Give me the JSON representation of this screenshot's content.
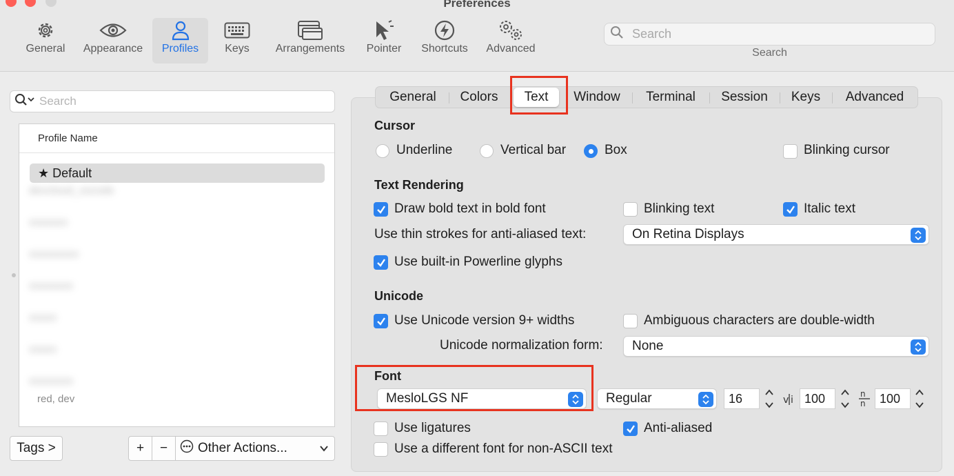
{
  "window": {
    "title": "Preferences"
  },
  "toolbar": {
    "items": [
      {
        "label": "General",
        "icon": "gear-icon"
      },
      {
        "label": "Appearance",
        "icon": "eye-icon"
      },
      {
        "label": "Profiles",
        "icon": "person-icon",
        "active": true
      },
      {
        "label": "Keys",
        "icon": "keyboard-icon"
      },
      {
        "label": "Arrangements",
        "icon": "windows-icon"
      },
      {
        "label": "Pointer",
        "icon": "pointer-icon"
      },
      {
        "label": "Shortcuts",
        "icon": "bolt-icon"
      },
      {
        "label": "Advanced",
        "icon": "gears-icon"
      }
    ],
    "search": {
      "placeholder": "Search",
      "caption": "Search"
    }
  },
  "profiles": {
    "search_placeholder": "Search",
    "column_header": "Profile Name",
    "default_profile": "★ Default",
    "blurred_rows": [
      "devcloud_vscode",
      "xxxxxxx",
      "xxxxxxxxx",
      "xxxxxxxx",
      "xxxxx",
      "xxxxx",
      "xxxxxxxx",
      "xxxx",
      "red, dev"
    ],
    "tags_button": "Tags >",
    "add_button": "+",
    "remove_button": "−",
    "other_actions": "Other Actions..."
  },
  "tabs": {
    "items": [
      "General",
      "Colors",
      "Text",
      "Window",
      "Terminal",
      "Session",
      "Keys",
      "Advanced"
    ],
    "active": "Text"
  },
  "cursor": {
    "heading": "Cursor",
    "options": [
      "Underline",
      "Vertical bar",
      "Box"
    ],
    "selected": "Box",
    "blinking_label": "Blinking cursor",
    "blinking": false
  },
  "text_rendering": {
    "heading": "Text Rendering",
    "bold_label": "Draw bold text in bold font",
    "bold": true,
    "blinking_text_label": "Blinking text",
    "blinking_text": false,
    "italic_label": "Italic text",
    "italic": true,
    "thin_strokes_label": "Use thin strokes for anti-aliased text:",
    "thin_strokes_value": "On Retina Displays",
    "powerline_label": "Use built-in Powerline glyphs",
    "powerline": true
  },
  "unicode": {
    "heading": "Unicode",
    "v9_label": "Use Unicode version 9+ widths",
    "v9": true,
    "ambiguous_label": "Ambiguous characters are double-width",
    "ambiguous": false,
    "normalization_label": "Unicode normalization form:",
    "normalization_value": "None"
  },
  "font": {
    "heading": "Font",
    "family": "MesloLGS NF",
    "style": "Regular",
    "size": "16",
    "vertical_spacing": "100",
    "horizontal_spacing": "100",
    "ligatures_label": "Use ligatures",
    "ligatures": false,
    "antialiased_label": "Anti-aliased",
    "antialiased": true,
    "non_ascii_label": "Use a different font for non-ASCII text",
    "non_ascii": false
  },
  "colors": {
    "accent": "#2c82ee",
    "highlight": "#e8331f",
    "active_toolbar": "#2272e5"
  }
}
